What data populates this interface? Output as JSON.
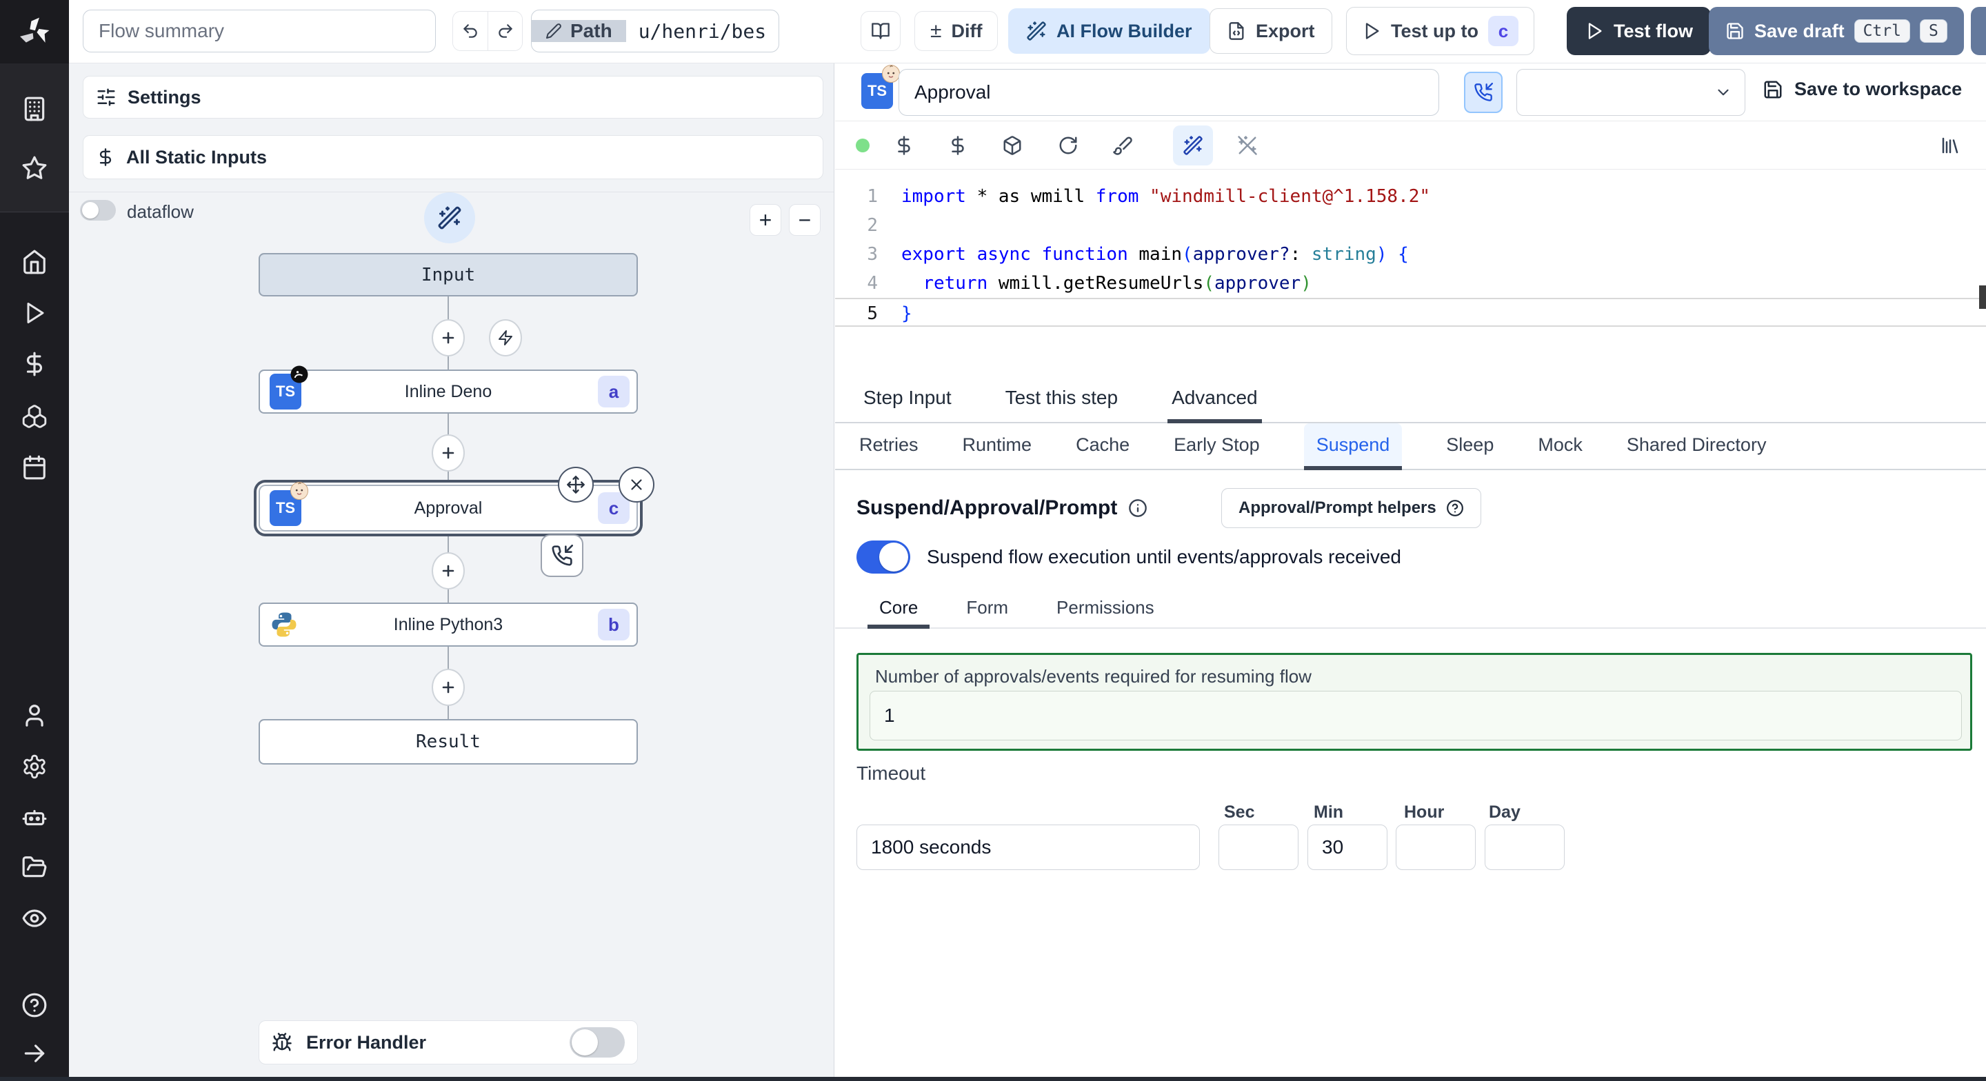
{
  "topbar": {
    "flow_summary_placeholder": "Flow summary",
    "path": {
      "label": "Path",
      "value": "u/henri/bes"
    },
    "diff_label": "Diff",
    "diff_symbol": "±",
    "ai_flow_builder_label": "AI Flow Builder",
    "export_label": "Export",
    "test_up_to": {
      "label": "Test up to",
      "badge": "c"
    },
    "test_flow_label": "Test flow",
    "save_draft": {
      "label": "Save draft",
      "kbd1": "Ctrl",
      "kbd2": "S"
    }
  },
  "sidebar": {
    "icons": [
      "windmill-logo",
      "building-icon",
      "star-icon",
      "home-icon",
      "play-icon",
      "dollar-icon",
      "boxes-icon",
      "calendar-icon",
      "user-icon",
      "gear-icon",
      "bot-icon",
      "folder-open-icon",
      "eye-icon",
      "help-circle-icon",
      "arrow-right-icon"
    ]
  },
  "graph": {
    "settings_label": "Settings",
    "static_inputs_label": "All Static Inputs",
    "dataflow_label": "dataflow",
    "dataflow_on": false,
    "zoom_in_label": "+",
    "zoom_out_label": "−",
    "nodes": {
      "input_label": "Input",
      "deno": {
        "title": "Inline Deno",
        "badge": "a"
      },
      "approval": {
        "title": "Approval",
        "badge": "c"
      },
      "python": {
        "title": "Inline Python3",
        "badge": "b"
      },
      "result_label": "Result"
    },
    "error_handler": {
      "label": "Error Handler",
      "enabled": false
    }
  },
  "step_header": {
    "name_value": "Approval",
    "save_to_workspace_label": "Save to workspace"
  },
  "code": {
    "language": "typescript",
    "lines": [
      {
        "num": "1",
        "current": false,
        "tokens": [
          [
            "import",
            "kw"
          ],
          [
            " * as wmill ",
            "pl"
          ],
          [
            "from",
            "kw"
          ],
          [
            " ",
            "pl"
          ],
          [
            "\"windmill-client@^1.158.2\"",
            "str"
          ]
        ]
      },
      {
        "num": "2",
        "current": false,
        "tokens": []
      },
      {
        "num": "3",
        "current": false,
        "tokens": [
          [
            "export",
            "kw"
          ],
          [
            " ",
            "pl"
          ],
          [
            "async",
            "kw"
          ],
          [
            " ",
            "pl"
          ],
          [
            "function",
            "kw"
          ],
          [
            " main",
            "pl"
          ],
          [
            "(",
            "b1"
          ],
          [
            "approver?",
            "prm"
          ],
          [
            ": ",
            "pl"
          ],
          [
            "string",
            "typ"
          ],
          [
            ")",
            "b1"
          ],
          [
            " ",
            "pl"
          ],
          [
            "{",
            "b1"
          ]
        ]
      },
      {
        "num": "4",
        "current": false,
        "tokens": [
          [
            "  ",
            "pl"
          ],
          [
            "return",
            "kw"
          ],
          [
            " wmill.getResumeUrls",
            "pl"
          ],
          [
            "(",
            "b2"
          ],
          [
            "approver",
            "prm"
          ],
          [
            ")",
            "b2"
          ]
        ]
      },
      {
        "num": "5",
        "current": true,
        "tokens": [
          [
            "}",
            "b1"
          ]
        ]
      }
    ]
  },
  "tabs": {
    "main": [
      "Step Input",
      "Test this step",
      "Advanced"
    ],
    "main_active": "Advanced",
    "advanced": [
      "Retries",
      "Runtime",
      "Cache",
      "Early Stop",
      "Suspend",
      "Sleep",
      "Mock",
      "Shared Directory"
    ],
    "advanced_active": "Suspend"
  },
  "suspend": {
    "title": "Suspend/Approval/Prompt",
    "helpers_button_label": "Approval/Prompt helpers",
    "toggle_label": "Suspend flow execution until events/approvals received",
    "toggle_on": true,
    "sub_tabs": [
      "Core",
      "Form",
      "Permissions"
    ],
    "sub_tabs_active": "Core",
    "approvals": {
      "label": "Number of approvals/events required for resuming flow",
      "value": "1"
    },
    "timeout": {
      "label": "Timeout",
      "summary_value": "1800 seconds",
      "fields": [
        {
          "label": "Sec",
          "value": ""
        },
        {
          "label": "Min",
          "value": "30"
        },
        {
          "label": "Hour",
          "value": ""
        },
        {
          "label": "Day",
          "value": ""
        }
      ]
    }
  },
  "colors": {
    "accent_blue": "#2e61e6",
    "badge_bg": "#e0e7ff",
    "badge_text": "#4f46e5",
    "green_border": "#1b7a38",
    "dark_button_bg": "#2b3544",
    "save_draft_bg": "#64799c",
    "ai_builder_bg": "#dbeafe",
    "status_dot_green": "#7ee08a"
  }
}
